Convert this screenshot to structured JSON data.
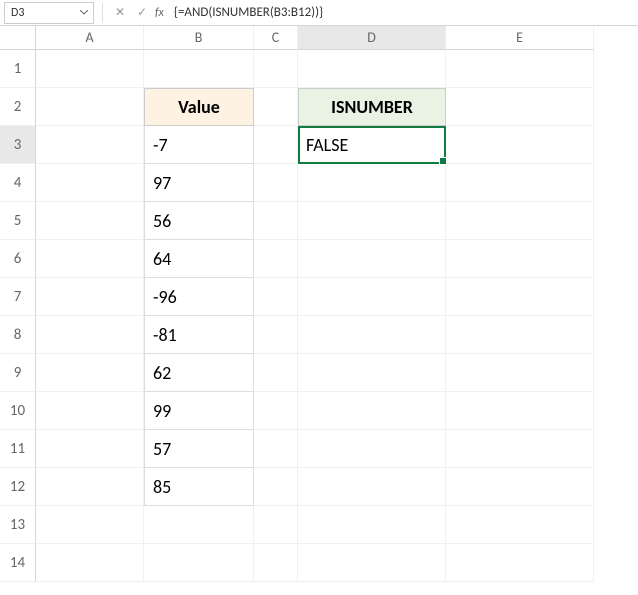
{
  "nameBox": "D3",
  "formula": "{=AND(ISNUMBER(B3:B12))}",
  "fxLabel": "fx",
  "columns": [
    "A",
    "B",
    "C",
    "D",
    "E"
  ],
  "rows": [
    "1",
    "2",
    "3",
    "4",
    "5",
    "6",
    "7",
    "8",
    "9",
    "10",
    "11",
    "12",
    "13",
    "14"
  ],
  "headers": {
    "value": "Value",
    "isnumber": "ISNUMBER"
  },
  "data": {
    "b3": "-7",
    "b4": "97",
    "b5": "56",
    "b6": "64",
    "b7": "-96",
    "b8": "-81",
    "b9": "62",
    "b10": "99",
    "b11": "57",
    "b12": "85",
    "d3": "FALSE"
  },
  "fb": {
    "cancel": "✕",
    "confirm": "✓"
  }
}
